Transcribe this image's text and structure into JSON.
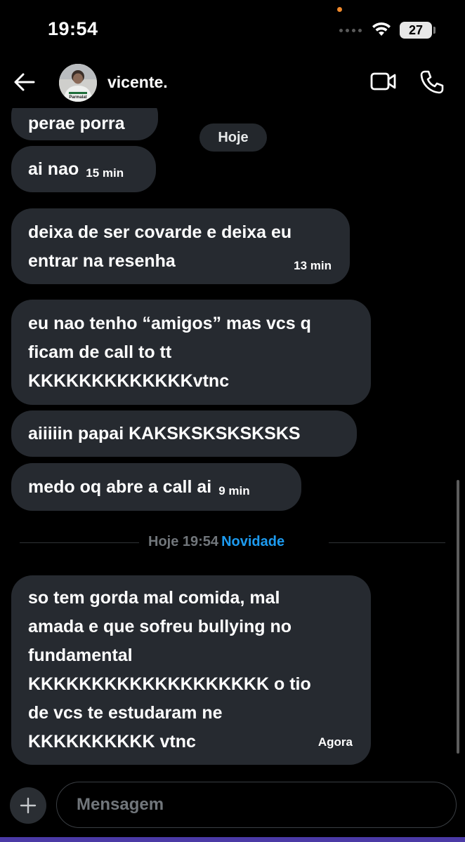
{
  "status_bar": {
    "time": "19:54",
    "battery": "27"
  },
  "header": {
    "contact_name": "vicente.",
    "avatar_text": "Parmalat"
  },
  "date_pill": "Hoje",
  "messages": [
    {
      "text": "perae porra",
      "time": ""
    },
    {
      "text": "ai nao",
      "time": "15 min"
    },
    {
      "lines": [
        "deixa de ser covarde e deixa eu",
        "entrar na resenha"
      ],
      "time": "13 min"
    },
    {
      "lines": [
        "eu nao tenho “amigos” mas vcs q",
        "ficam de call to tt",
        "KKKKKKKKKKKKKvtnc"
      ],
      "time": ""
    },
    {
      "text": "aiiiiin papai KAKSKSKSKSKSKS",
      "time": ""
    },
    {
      "text": "medo oq abre a call ai",
      "time": "9 min"
    },
    {
      "lines": [
        "so tem gorda mal comida, mal",
        "amada e que sofreu bullying no",
        "fundamental",
        "KKKKKKKKKKKKKKKKKKK o tio",
        "de vcs te estudaram ne",
        "KKKKKKKKKK vtnc"
      ],
      "time": "Agora"
    }
  ],
  "divider": {
    "label": "Hoje 19:54",
    "new_label": "Novidade"
  },
  "composer": {
    "placeholder": "Mensagem"
  },
  "colors": {
    "bubble": "#262a30",
    "accent": "#1d9bf0",
    "background": "#000000",
    "muted": "#71767b"
  },
  "icons": [
    "back-arrow-icon",
    "video-call-icon",
    "phone-icon",
    "plus-icon",
    "wifi-icon",
    "battery-icon"
  ]
}
